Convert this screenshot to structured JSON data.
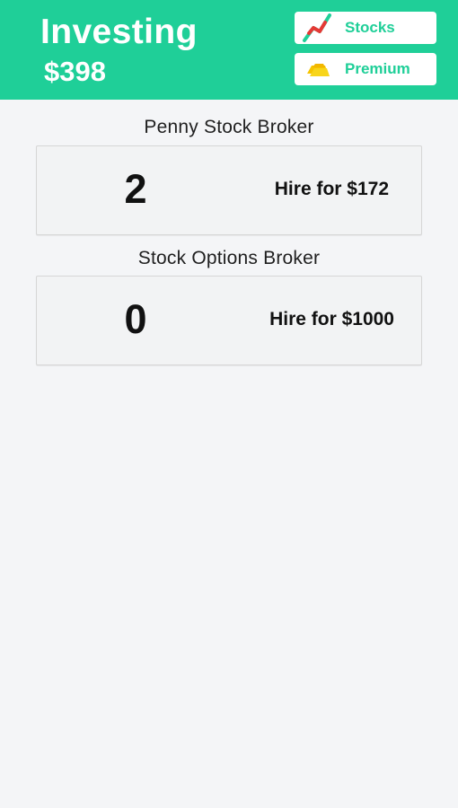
{
  "header": {
    "title": "Investing",
    "balance": "$398",
    "buttons": {
      "stocks": {
        "label": "Stocks",
        "icon": "stock-chart-icon"
      },
      "premium": {
        "label": "Premium",
        "icon": "gold-bars-icon"
      }
    },
    "colors": {
      "accent": "#1fcf98",
      "header_text": "#ffffff"
    }
  },
  "brokers": [
    {
      "title": "Penny Stock Broker",
      "count": "2",
      "hire_label": "Hire for $172"
    },
    {
      "title": "Stock Options Broker",
      "count": "0",
      "hire_label": "Hire for $1000"
    }
  ]
}
